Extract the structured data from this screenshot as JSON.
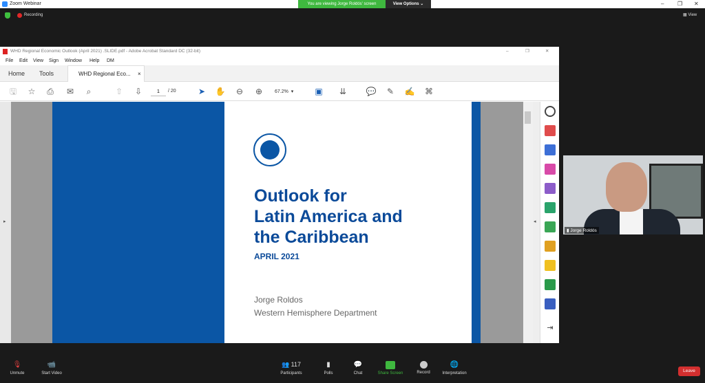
{
  "zoom": {
    "window_title": "Zoom Webinar",
    "viewing_banner": "You are viewing Jorge Roldós' screen",
    "view_options": "View Options ⌄",
    "recording": "Recording",
    "view_button": "View"
  },
  "acrobat": {
    "window_title": "WHD Regional Economic Outlook (April 2021) .SLIDE.pdf - Adobe Acrobat Standard DC (32-bit)",
    "menu": [
      "File",
      "Edit",
      "View",
      "Sign",
      "Window",
      "Help",
      "DM"
    ],
    "tabs": {
      "home": "Home",
      "tools": "Tools",
      "document": "WHD Regional Eco...",
      "close": "×"
    },
    "page_current": "1",
    "page_total": "/ 20",
    "zoom": "67.2%"
  },
  "slide": {
    "title_line1": "Outlook for",
    "title_line2": "Latin America and",
    "title_line3": "the Caribbean",
    "date": "APRIL 2021",
    "author": "Jorge Roldos",
    "department": "Western Hemisphere Department"
  },
  "video": {
    "participant_name": "Jorge Roldós"
  },
  "bottom": {
    "unmute": "Unmute",
    "start_video": "Start Video",
    "participants": "Participants",
    "participants_count": "117",
    "polls": "Polls",
    "chat": "Chat",
    "share_screen": "Share Screen",
    "record": "Record",
    "interpretation": "Interpretation",
    "leave": "Leave"
  },
  "colors": {
    "imf_blue": "#0b56a5",
    "share_green": "#3fb83f",
    "leave_red": "#d32f2f"
  }
}
